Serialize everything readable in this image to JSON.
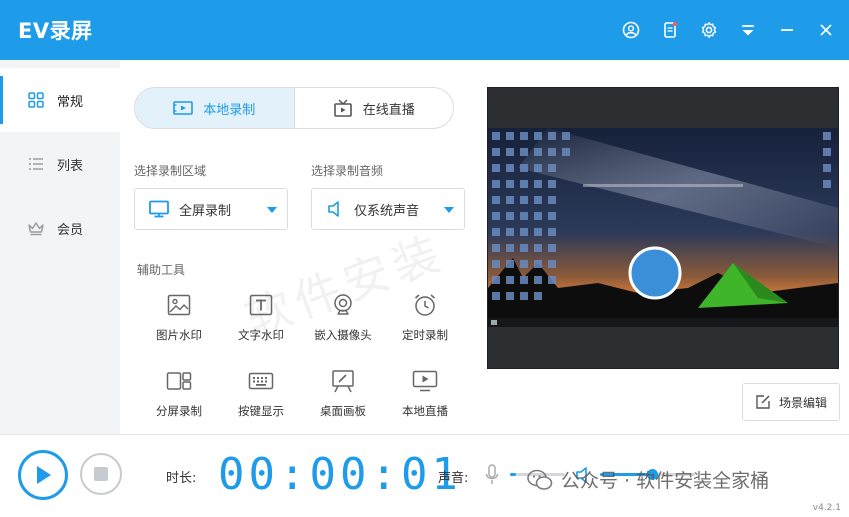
{
  "app": {
    "title": "EV录屏",
    "version": "v4.2.1"
  },
  "titlebar": {
    "icons": [
      "user-icon",
      "notification-icon",
      "gear-icon",
      "menu-icon",
      "minimize-icon",
      "close-icon"
    ]
  },
  "sidebar": {
    "items": [
      {
        "label": "常规",
        "icon": "grid-icon",
        "active": true
      },
      {
        "label": "列表",
        "icon": "list-icon",
        "active": false
      },
      {
        "label": "会员",
        "icon": "crown-icon",
        "active": false
      }
    ]
  },
  "mode_tabs": [
    {
      "label": "本地录制",
      "icon": "record-icon",
      "active": true
    },
    {
      "label": "在线直播",
      "icon": "broadcast-icon",
      "active": false
    }
  ],
  "area": {
    "label": "选择录制区域",
    "value": "全屏录制",
    "icon": "monitor-icon"
  },
  "audio": {
    "label": "选择录制音频",
    "value": "仅系统声音",
    "icon": "speaker-icon"
  },
  "tools": {
    "label": "辅助工具",
    "items": [
      {
        "label": "图片水印",
        "icon": "image-icon"
      },
      {
        "label": "文字水印",
        "icon": "text-icon"
      },
      {
        "label": "嵌入摄像头",
        "icon": "webcam-icon"
      },
      {
        "label": "定时录制",
        "icon": "alarm-icon"
      },
      {
        "label": "分屏录制",
        "icon": "split-screen-icon"
      },
      {
        "label": "按键显示",
        "icon": "keyboard-icon"
      },
      {
        "label": "桌面画板",
        "icon": "easel-icon"
      },
      {
        "label": "本地直播",
        "icon": "local-live-icon"
      }
    ]
  },
  "scene_edit": {
    "label": "场景编辑"
  },
  "bottom": {
    "duration_label": "时长:",
    "timer": "00:00:01",
    "sound_label": "声音:",
    "mic_level": 0.1,
    "speaker_level": 0.55
  },
  "watermark": {
    "text": "公众号 · 软件安装全家桶",
    "bg_text": "软件安装"
  },
  "colors": {
    "accent": "#1e9be9",
    "titlebar": "#1e9be9",
    "sidebar_bg": "#f3f4f6"
  }
}
